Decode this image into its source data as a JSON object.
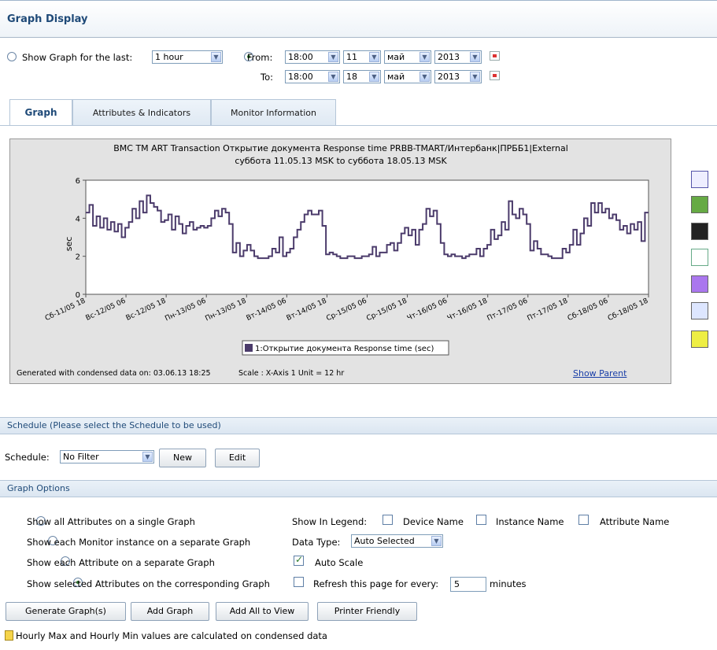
{
  "header": {
    "title": "Graph Display"
  },
  "time": {
    "show_last_label": "Show Graph for the last:",
    "last_value": "1 hour",
    "from_label": "From:",
    "to_label": "To:",
    "from": {
      "time": "18:00",
      "day": "11",
      "month": "май",
      "year": "2013"
    },
    "to": {
      "time": "18:00",
      "day": "18",
      "month": "май",
      "year": "2013"
    }
  },
  "tabs": [
    {
      "label": "Graph"
    },
    {
      "label": "Attributes & Indicators"
    },
    {
      "label": "Monitor Information"
    }
  ],
  "chart": {
    "footer_generated": "Generated with condensed data on: 03.06.13 18:25",
    "footer_scale": "Scale : X-Axis 1 Unit = 12 hr",
    "show_parent": "Show Parent"
  },
  "chart_data": {
    "type": "line",
    "title": "BMC TM ART Transaction Открытие документа Response time PRBB-TMART/Интербанк|ПРББ1|External",
    "subtitle": "суббота 11.05.13 MSK to суббота 18.05.13 MSK",
    "ylabel": "sec",
    "ylim": [
      0,
      6
    ],
    "yticks": [
      "0",
      "2",
      "4",
      "6"
    ],
    "xticks": [
      "Сб-11/05 18",
      "Вс-12/05 06",
      "Вс-12/05 18",
      "Пн-13/05 06",
      "Пн-13/05 18",
      "Вт-14/05 06",
      "Вт-14/05 18",
      "Ср-15/05 06",
      "Ср-15/05 18",
      "Чт-16/05 06",
      "Чт-16/05 18",
      "Пт-17/05 06",
      "Пт-17/05 18",
      "Сб-18/05 06",
      "Сб-18/05 18"
    ],
    "series": [
      {
        "name": "1:Открытие документа Response time (sec)",
        "color": "#4b3b6b",
        "values": [
          4.3,
          4.7,
          3.6,
          4.1,
          3.5,
          4.0,
          3.4,
          3.8,
          3.3,
          3.7,
          3.0,
          3.5,
          3.8,
          4.5,
          4.0,
          4.9,
          4.3,
          5.2,
          4.8,
          4.6,
          4.4,
          3.8,
          3.9,
          4.2,
          3.4,
          4.1,
          3.7,
          3.2,
          3.6,
          3.8,
          3.4,
          3.5,
          3.6,
          3.5,
          3.6,
          4.0,
          4.4,
          4.1,
          4.5,
          4.3,
          3.7,
          2.2,
          2.7,
          2.0,
          2.3,
          2.6,
          2.3,
          2.0,
          1.9,
          1.9,
          1.9,
          2.0,
          2.4,
          2.2,
          3.0,
          2.0,
          2.2,
          2.4,
          3.0,
          3.4,
          3.8,
          4.2,
          4.4,
          4.2,
          4.2,
          4.4,
          3.6,
          2.1,
          2.2,
          2.1,
          2.0,
          1.9,
          1.9,
          2.0,
          2.0,
          1.9,
          1.9,
          2.0,
          2.0,
          2.1,
          2.5,
          2.0,
          2.2,
          2.2,
          2.6,
          2.7,
          2.3,
          2.7,
          3.2,
          3.5,
          3.1,
          3.4,
          2.6,
          3.4,
          3.7,
          4.5,
          4.1,
          4.4,
          3.7,
          2.7,
          2.1,
          2.0,
          2.1,
          2.0,
          2.0,
          1.9,
          2.0,
          2.1,
          2.1,
          2.4,
          2.0,
          2.4,
          2.6,
          3.4,
          2.9,
          3.1,
          3.8,
          3.4,
          4.9,
          4.2,
          4.0,
          4.5,
          4.2,
          3.7,
          2.3,
          2.8,
          2.4,
          2.1,
          2.1,
          2.0,
          1.9,
          1.9,
          1.9,
          2.4,
          2.2,
          2.6,
          3.4,
          2.6,
          3.2,
          4.0,
          3.6,
          4.8,
          4.3,
          4.8,
          4.3,
          4.5,
          4.0,
          4.2,
          3.9,
          3.4,
          3.6,
          3.2,
          3.7,
          3.4,
          3.8,
          2.8,
          4.3
        ]
      }
    ],
    "legend_position": "bottom-center",
    "grid": false
  },
  "side_icons": [
    "zoom-icon",
    "export-icon",
    "binoculars-add-icon",
    "graph-add-icon",
    "alert-icon",
    "link-icon",
    "report-icon"
  ],
  "schedule": {
    "section_title": "Schedule (Please select the Schedule to be used)",
    "label": "Schedule:",
    "value": "No Filter",
    "new_btn": "New",
    "edit_btn": "Edit"
  },
  "options": {
    "section_title": "Graph Options",
    "radios": [
      {
        "label": "Show all Attributes on a single Graph",
        "checked": false
      },
      {
        "label": "Show each Monitor instance on a separate Graph",
        "checked": false
      },
      {
        "label": "Show each Attribute on a separate Graph",
        "checked": false
      },
      {
        "label": "Show selected Attributes on the corresponding Graph",
        "checked": true
      }
    ],
    "show_in_legend": "Show In Legend:",
    "legend_device": "Device Name",
    "legend_instance": "Instance Name",
    "legend_attribute": "Attribute Name",
    "data_type_label": "Data Type:",
    "data_type_value": "Auto Selected",
    "auto_scale": "Auto Scale",
    "refresh_label": "Refresh this page for every:",
    "refresh_value": "5",
    "minutes": "minutes"
  },
  "buttons": {
    "generate": "Generate Graph(s)",
    "add_graph": "Add Graph",
    "add_all": "Add All to View",
    "printer": "Printer Friendly"
  },
  "note": "Hourly Max and Hourly Min values are calculated on condensed data"
}
